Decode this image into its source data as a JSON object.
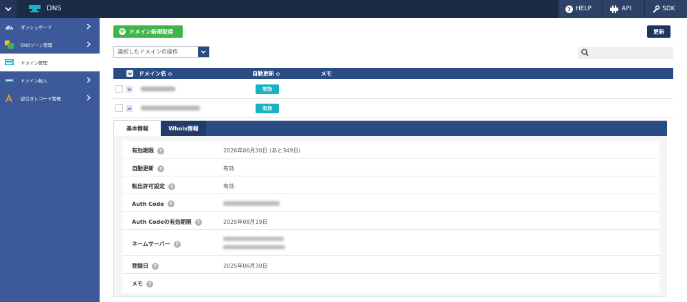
{
  "topbar": {
    "title": "DNS",
    "help_label": "HELP",
    "api_label": "API",
    "sdk_label": "SDK"
  },
  "sidebar": {
    "items": [
      {
        "label": "ダッシュボード",
        "icon": "dashboard-icon",
        "active": false,
        "has_chevron": true
      },
      {
        "label": "DNSゾーン管理",
        "icon": "dns-zone-icon",
        "active": false,
        "has_chevron": true
      },
      {
        "label": "ドメイン管理",
        "icon": "domain-icon",
        "active": true,
        "has_chevron": false
      },
      {
        "label": "ドメイン転入",
        "icon": "domain-transfer-icon",
        "active": false,
        "has_chevron": true
      },
      {
        "label": "逆引きレコード管理",
        "icon": "reverse-record-icon",
        "active": false,
        "has_chevron": true
      }
    ]
  },
  "toolbar": {
    "add_label": "ドメイン新規取得",
    "refresh_label": "更新",
    "bulk_placeholder": "選択したドメインの操作",
    "search_value": ""
  },
  "table": {
    "headers": {
      "name": "ドメイン名",
      "auto_renew": "自動更新",
      "memo": "メモ"
    },
    "rows": [
      {
        "domain": "",
        "auto_renew": "有効",
        "expanded": false
      },
      {
        "domain": "",
        "auto_renew": "有効",
        "expanded": true
      }
    ]
  },
  "detail": {
    "tabs": {
      "basic": "基本情報",
      "whois": "Whois情報"
    },
    "fields": [
      {
        "label": "有効期限",
        "value": "2026年06月30日 (あと349日)"
      },
      {
        "label": "自動更新",
        "value": "有効"
      },
      {
        "label": "転出許可設定",
        "value": "有効"
      },
      {
        "label": "Auth Code",
        "value": ""
      },
      {
        "label": "Auth Codeの有効期限",
        "value": "2025年08月19日"
      },
      {
        "label": "ネームサーバー",
        "value": ""
      },
      {
        "label": "登録日",
        "value": "2025年06月30日"
      },
      {
        "label": "メモ",
        "value": ""
      }
    ]
  },
  "colors": {
    "topbar": "#1b2a45",
    "sidebar": "#3c5a9a",
    "header": "#294c85",
    "add_button": "#3fb449",
    "badge": "#17b3c4"
  }
}
